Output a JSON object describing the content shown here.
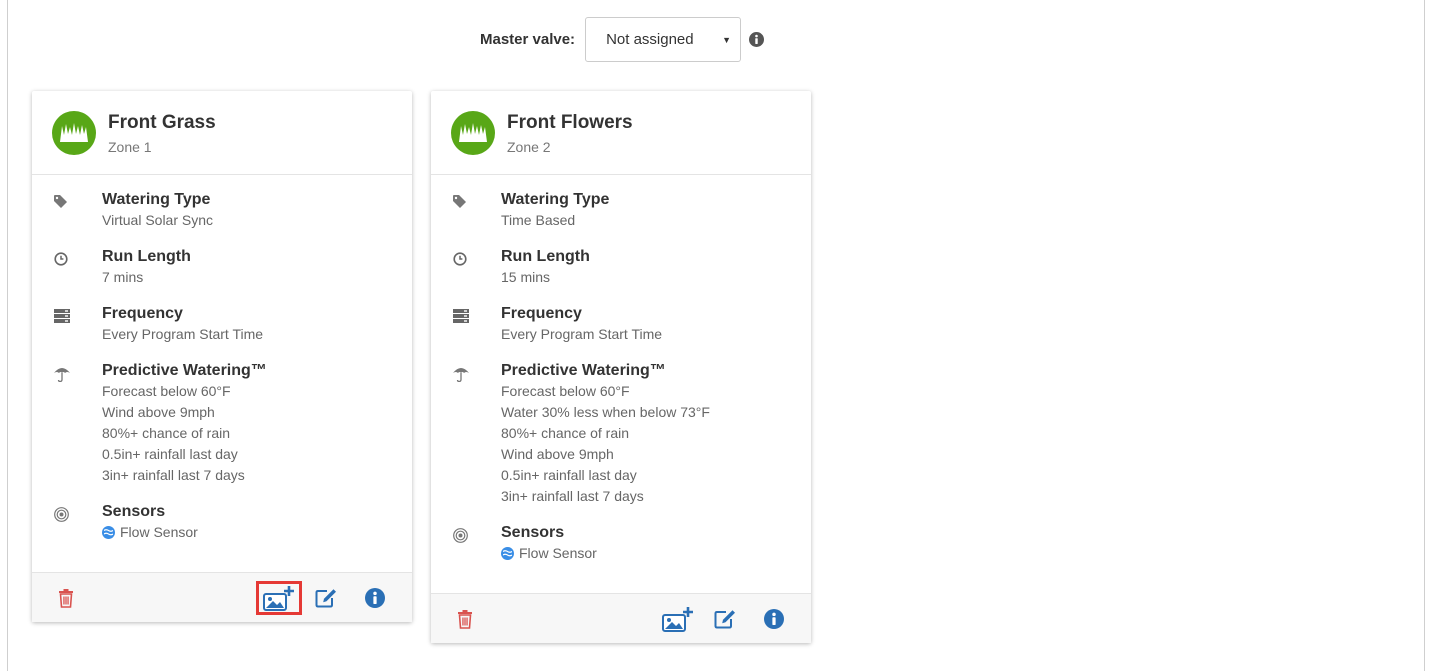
{
  "master_valve": {
    "label": "Master valve:",
    "selected": "Not assigned"
  },
  "zones": [
    {
      "name": "Front Grass",
      "zone_label": "Zone 1",
      "watering_type_title": "Watering Type",
      "watering_type": "Virtual Solar Sync",
      "run_length_title": "Run Length",
      "run_length": "7 mins",
      "frequency_title": "Frequency",
      "frequency": "Every Program Start Time",
      "predictive_title": "Predictive Watering™",
      "predictive_items": [
        "Forecast below 60°F",
        "Wind above 9mph",
        "80%+ chance of rain",
        "0.5in+ rainfall last day",
        "3in+ rainfall last 7 days"
      ],
      "sensors_title": "Sensors",
      "sensor": "Flow Sensor"
    },
    {
      "name": "Front Flowers",
      "zone_label": "Zone 2",
      "watering_type_title": "Watering Type",
      "watering_type": "Time Based",
      "run_length_title": "Run Length",
      "run_length": "15 mins",
      "frequency_title": "Frequency",
      "frequency": "Every Program Start Time",
      "predictive_title": "Predictive Watering™",
      "predictive_items": [
        "Forecast below 60°F",
        "Water 30% less when below 73°F",
        "80%+ chance of rain",
        "Wind above 9mph",
        "0.5in+ rainfall last day",
        "3in+ rainfall last 7 days"
      ],
      "sensors_title": "Sensors",
      "sensor": "Flow Sensor"
    }
  ],
  "colors": {
    "zone_avatar": "#58a717",
    "delete": "#d9534f",
    "action_blue": "#2a6fb5",
    "highlight": "#e53935"
  }
}
